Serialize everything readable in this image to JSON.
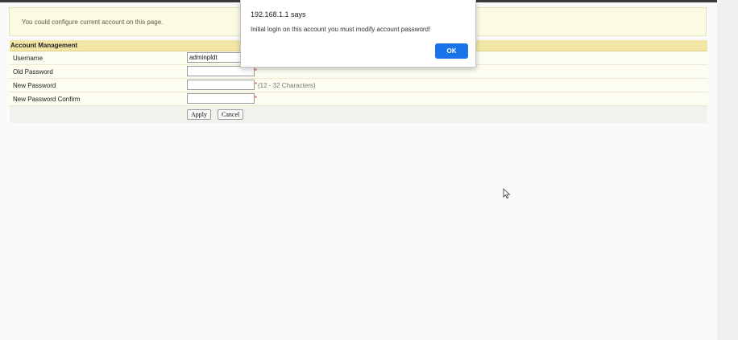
{
  "info": {
    "text": "You could configure current account on this page."
  },
  "panel": {
    "title": "Account Management",
    "rows": [
      {
        "label": "Username",
        "value": "adminpldt"
      },
      {
        "label": "Old Password",
        "value": "",
        "required": "*"
      },
      {
        "label": "New Password",
        "value": "",
        "required": "*",
        "hint": "(12 - 32 Characters)"
      },
      {
        "label": "New Password Confirm",
        "value": "",
        "required": "*"
      }
    ],
    "apply_label": "Apply",
    "cancel_label": "Cancel"
  },
  "dialog": {
    "title": "192.168.1.1 says",
    "message": "Initial login on this account you must modify account password!",
    "ok_label": "OK"
  },
  "colors": {
    "header_bg": "#f2e6a6",
    "info_bg": "#fbfbe4",
    "required": "#d23a3a",
    "ok_button": "#1a73e8"
  },
  "icons": {
    "cursor": "mouse-pointer-icon"
  }
}
